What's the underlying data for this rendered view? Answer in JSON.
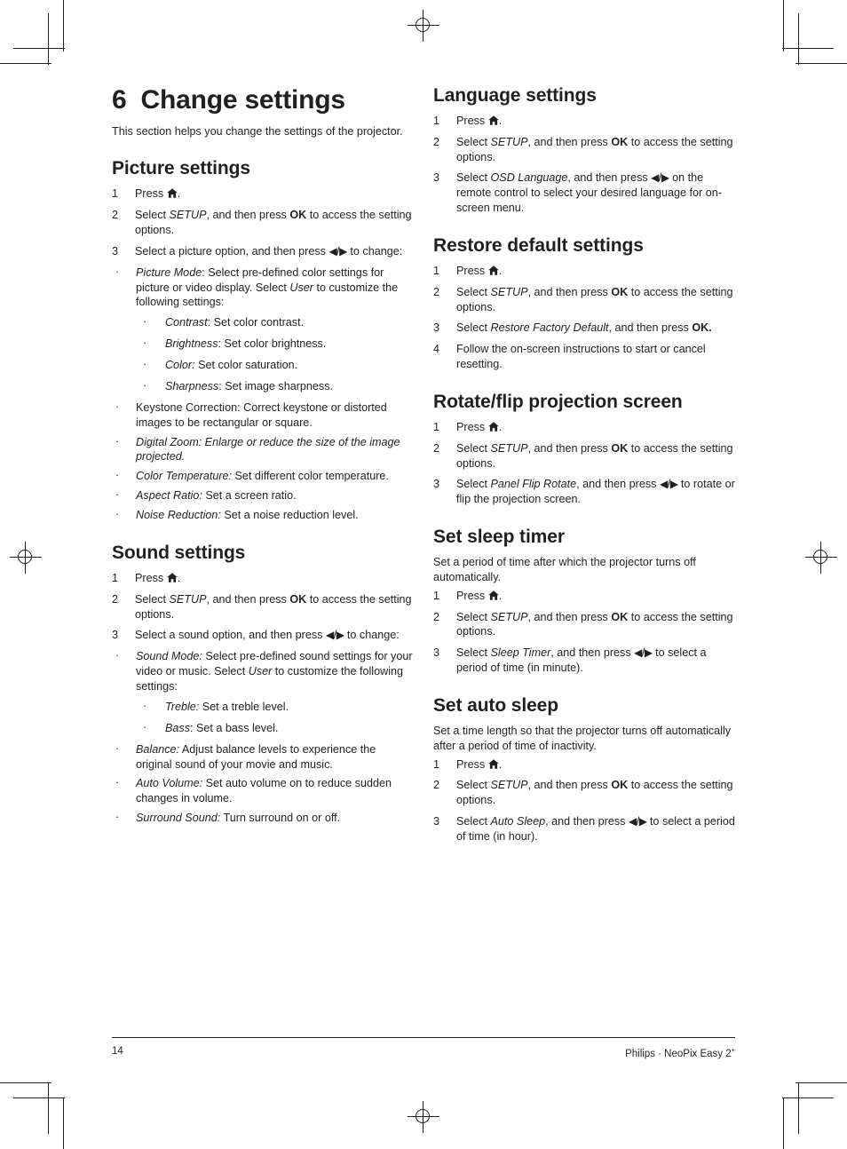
{
  "document": {
    "chapter_number": "6",
    "chapter_title": "Change settings",
    "intro": "This section helps you change the settings of the projector."
  },
  "icons": {
    "home": "home-icon",
    "left_right_arrows": "left-right-arrow-icons",
    "left_arrow": "left-arrow-icon",
    "right_arrow": "right-arrow-icon"
  },
  "left_column": {
    "picture_settings": {
      "heading": "Picture settings",
      "steps": [
        {
          "index": "1",
          "parts": [
            {
              "t": "Press ",
              "s": "n"
            },
            {
              "t": "HOME",
              "s": "icon"
            },
            {
              "t": ".",
              "s": "n"
            }
          ]
        },
        {
          "index": "2",
          "parts": [
            {
              "t": "Select ",
              "s": "n"
            },
            {
              "t": "SETUP",
              "s": "i"
            },
            {
              "t": ", and then press ",
              "s": "n"
            },
            {
              "t": "OK",
              "s": "b"
            },
            {
              "t": " to access the setting options.",
              "s": "n"
            }
          ]
        },
        {
          "index": "3",
          "parts": [
            {
              "t": "Select a picture option, and then press ",
              "s": "n"
            },
            {
              "t": "ARROWS",
              "s": "arrows"
            },
            {
              "t": " to change:",
              "s": "n"
            }
          ]
        }
      ],
      "bullets": [
        {
          "parts": [
            {
              "t": "Picture Mode",
              "s": "i"
            },
            {
              "t": ": Select pre-defined color settings for picture or video display. Select ",
              "s": "n"
            },
            {
              "t": "User",
              "s": "i"
            },
            {
              "t": " to customize the following settings:",
              "s": "n"
            }
          ],
          "sub": [
            {
              "parts": [
                {
                  "t": "Contrast",
                  "s": "i"
                },
                {
                  "t": ": Set color contrast.",
                  "s": "n"
                }
              ]
            },
            {
              "parts": [
                {
                  "t": "Brightness",
                  "s": "i"
                },
                {
                  "t": ": Set color brightness.",
                  "s": "n"
                }
              ]
            },
            {
              "parts": [
                {
                  "t": "Color:",
                  "s": "i"
                },
                {
                  "t": " Set color saturation.",
                  "s": "n"
                }
              ]
            },
            {
              "parts": [
                {
                  "t": "Sharpness",
                  "s": "i"
                },
                {
                  "t": ": Set image sharpness.",
                  "s": "n"
                }
              ]
            }
          ]
        },
        {
          "parts": [
            {
              "t": "Keystone Correction: Correct keystone or distorted images to be rectangular or square.",
              "s": "n"
            }
          ]
        },
        {
          "parts": [
            {
              "t": "Digital Zoom: Enlarge or reduce the size of the image projected.",
              "s": "i"
            }
          ]
        },
        {
          "parts": [
            {
              "t": "Color Temperature:",
              "s": "i"
            },
            {
              "t": " Set different color temperature.",
              "s": "n"
            }
          ]
        },
        {
          "parts": [
            {
              "t": "Aspect Ratio:",
              "s": "i"
            },
            {
              "t": " Set a screen ratio.",
              "s": "n"
            }
          ]
        },
        {
          "parts": [
            {
              "t": "Noise Reduction:",
              "s": "i"
            },
            {
              "t": " Set a noise reduction level.",
              "s": "n"
            }
          ]
        }
      ]
    },
    "sound_settings": {
      "heading": "Sound settings",
      "steps": [
        {
          "index": "1",
          "parts": [
            {
              "t": "Press ",
              "s": "n"
            },
            {
              "t": "HOME",
              "s": "icon"
            },
            {
              "t": ".",
              "s": "n"
            }
          ]
        },
        {
          "index": "2",
          "parts": [
            {
              "t": "Select ",
              "s": "n"
            },
            {
              "t": "SETUP",
              "s": "i"
            },
            {
              "t": ", and then press ",
              "s": "n"
            },
            {
              "t": "OK",
              "s": "b"
            },
            {
              "t": " to access the setting options.",
              "s": "n"
            }
          ]
        },
        {
          "index": "3",
          "parts": [
            {
              "t": "Select a sound option, and then press ",
              "s": "n"
            },
            {
              "t": "ARROWS",
              "s": "arrows"
            },
            {
              "t": " to change:",
              "s": "n"
            }
          ]
        }
      ],
      "bullets": [
        {
          "parts": [
            {
              "t": "Sound Mode:",
              "s": "i"
            },
            {
              "t": " Select pre-defined sound settings for your video or music. Select ",
              "s": "n"
            },
            {
              "t": "User",
              "s": "i"
            },
            {
              "t": " to customize the following settings:",
              "s": "n"
            }
          ],
          "sub": [
            {
              "parts": [
                {
                  "t": "Treble:",
                  "s": "i"
                },
                {
                  "t": " Set a treble level.",
                  "s": "n"
                }
              ]
            },
            {
              "parts": [
                {
                  "t": "Bass",
                  "s": "i"
                },
                {
                  "t": ": Set a bass level.",
                  "s": "n"
                }
              ]
            }
          ]
        },
        {
          "parts": [
            {
              "t": "Balance:",
              "s": "i"
            },
            {
              "t": " Adjust balance levels to experience the original sound of your movie and music.",
              "s": "n"
            }
          ]
        },
        {
          "parts": [
            {
              "t": "Auto Volume:",
              "s": "i"
            },
            {
              "t": " Set auto volume on to reduce sudden changes in volume.",
              "s": "n"
            }
          ]
        },
        {
          "parts": [
            {
              "t": "Surround Sound:",
              "s": "i"
            },
            {
              "t": " Turn surround on or off.",
              "s": "n"
            }
          ]
        }
      ]
    }
  },
  "right_column": {
    "language_settings": {
      "heading": "Language settings",
      "steps": [
        {
          "index": "1",
          "parts": [
            {
              "t": "Press ",
              "s": "n"
            },
            {
              "t": "HOME",
              "s": "icon"
            },
            {
              "t": ".",
              "s": "n"
            }
          ]
        },
        {
          "index": "2",
          "parts": [
            {
              "t": "Select ",
              "s": "n"
            },
            {
              "t": "SETUP",
              "s": "i"
            },
            {
              "t": ", and then press ",
              "s": "n"
            },
            {
              "t": "OK",
              "s": "b"
            },
            {
              "t": " to access the setting options.",
              "s": "n"
            }
          ]
        },
        {
          "index": "3",
          "parts": [
            {
              "t": "Select ",
              "s": "n"
            },
            {
              "t": "OSD Language",
              "s": "i"
            },
            {
              "t": ", and then press ",
              "s": "n"
            },
            {
              "t": "ARROWS",
              "s": "arrows"
            },
            {
              "t": " on the remote control to select your desired language for on-screen menu.",
              "s": "n"
            }
          ]
        }
      ]
    },
    "restore_default_settings": {
      "heading": "Restore default settings",
      "steps": [
        {
          "index": "1",
          "parts": [
            {
              "t": "Press ",
              "s": "n"
            },
            {
              "t": "HOME",
              "s": "icon"
            },
            {
              "t": ".",
              "s": "n"
            }
          ]
        },
        {
          "index": "2",
          "parts": [
            {
              "t": "Select ",
              "s": "n"
            },
            {
              "t": "SETUP",
              "s": "i"
            },
            {
              "t": ", and then press ",
              "s": "n"
            },
            {
              "t": "OK",
              "s": "b"
            },
            {
              "t": " to access the setting options.",
              "s": "n"
            }
          ]
        },
        {
          "index": "3",
          "parts": [
            {
              "t": "Select ",
              "s": "n"
            },
            {
              "t": "Restore Factory Default",
              "s": "i"
            },
            {
              "t": ", and then press ",
              "s": "n"
            },
            {
              "t": "OK.",
              "s": "b"
            }
          ]
        },
        {
          "index": "4",
          "parts": [
            {
              "t": "Follow the on-screen instructions to start or cancel resetting.",
              "s": "n"
            }
          ]
        }
      ]
    },
    "rotate_flip": {
      "heading": "Rotate/flip projection screen",
      "steps": [
        {
          "index": "1",
          "parts": [
            {
              "t": "Press ",
              "s": "n"
            },
            {
              "t": "HOME",
              "s": "icon"
            },
            {
              "t": ".",
              "s": "n"
            }
          ]
        },
        {
          "index": "2",
          "parts": [
            {
              "t": "Select ",
              "s": "n"
            },
            {
              "t": "SETUP",
              "s": "i"
            },
            {
              "t": ", and then press ",
              "s": "n"
            },
            {
              "t": "OK",
              "s": "b"
            },
            {
              "t": " to access the setting options.",
              "s": "n"
            }
          ]
        },
        {
          "index": "3",
          "parts": [
            {
              "t": "Select ",
              "s": "n"
            },
            {
              "t": "Panel Flip Rotate",
              "s": "i"
            },
            {
              "t": ", and then press ",
              "s": "n"
            },
            {
              "t": "ARROWS",
              "s": "arrows"
            },
            {
              "t": " to rotate or flip the projection screen.",
              "s": "n"
            }
          ]
        }
      ]
    },
    "set_sleep_timer": {
      "heading": "Set sleep timer",
      "intro": "Set a period of time after which the projector turns off automatically.",
      "steps": [
        {
          "index": "1",
          "parts": [
            {
              "t": "Press ",
              "s": "n"
            },
            {
              "t": "HOME",
              "s": "icon"
            },
            {
              "t": ".",
              "s": "n"
            }
          ]
        },
        {
          "index": "2",
          "parts": [
            {
              "t": "Select ",
              "s": "n"
            },
            {
              "t": "SETUP",
              "s": "i"
            },
            {
              "t": ", and then press ",
              "s": "n"
            },
            {
              "t": "OK",
              "s": "b"
            },
            {
              "t": " to access the setting options.",
              "s": "n"
            }
          ]
        },
        {
          "index": "3",
          "parts": [
            {
              "t": "Select ",
              "s": "n"
            },
            {
              "t": "Sleep Timer",
              "s": "i"
            },
            {
              "t": ", and then press ",
              "s": "n"
            },
            {
              "t": "ARROWS",
              "s": "arrows"
            },
            {
              "t": " to select a period of time (in minute).",
              "s": "n"
            }
          ]
        }
      ]
    },
    "set_auto_sleep": {
      "heading": "Set auto sleep",
      "intro": "Set a time length so that the projector turns off automatically after a period of time of inactivity.",
      "steps": [
        {
          "index": "1",
          "parts": [
            {
              "t": "Press ",
              "s": "n"
            },
            {
              "t": "HOME",
              "s": "icon"
            },
            {
              "t": ".",
              "s": "n"
            }
          ]
        },
        {
          "index": "2",
          "parts": [
            {
              "t": "Select ",
              "s": "n"
            },
            {
              "t": "SETUP",
              "s": "i"
            },
            {
              "t": ", and then press ",
              "s": "n"
            },
            {
              "t": "OK",
              "s": "b"
            },
            {
              "t": " to access the setting options.",
              "s": "n"
            }
          ]
        },
        {
          "index": "3",
          "parts": [
            {
              "t": "Select ",
              "s": "n"
            },
            {
              "t": "Auto Sleep",
              "s": "i"
            },
            {
              "t": ", and then press ",
              "s": "n"
            },
            {
              "t": "ARROWS",
              "s": "arrows"
            },
            {
              "t": " to select a period of time (in hour).",
              "s": "n"
            }
          ]
        }
      ]
    }
  },
  "footer": {
    "page_number": "14",
    "brand": "Philips · NeoPix Easy 2",
    "brand_superscript": "+"
  },
  "colors": {
    "text": "#231f20",
    "background": "#ffffff",
    "rule": "#231f20"
  }
}
